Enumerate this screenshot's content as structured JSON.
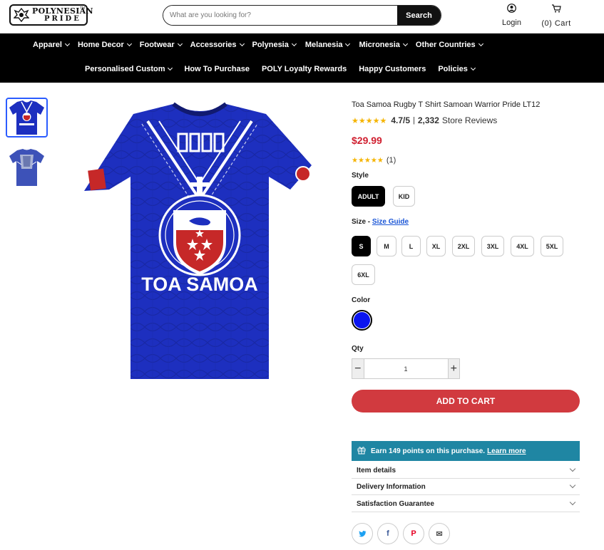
{
  "header": {
    "logo_line1": "POLYNESIAN",
    "logo_line2": "PRIDE",
    "logo_tm": "TM",
    "search_placeholder": "What are you looking for?",
    "search_button": "Search",
    "login_label": "Login",
    "cart_label": "(0) Cart"
  },
  "nav": {
    "row1": [
      {
        "label": "Apparel",
        "chevron": true
      },
      {
        "label": "Home Decor",
        "chevron": true
      },
      {
        "label": "Footwear",
        "chevron": true
      },
      {
        "label": "Accessories",
        "chevron": true
      },
      {
        "label": "Polynesia",
        "chevron": true
      },
      {
        "label": "Melanesia",
        "chevron": true
      },
      {
        "label": "Micronesia",
        "chevron": true
      },
      {
        "label": "Other Countries",
        "chevron": true
      }
    ],
    "row2": [
      {
        "label": "Personalised Custom",
        "chevron": true
      },
      {
        "label": "How To Purchase",
        "chevron": false
      },
      {
        "label": "POLY Loyalty Rewards",
        "chevron": false
      },
      {
        "label": "Happy Customers",
        "chevron": false
      },
      {
        "label": "Policies",
        "chevron": true
      }
    ]
  },
  "product": {
    "image_text": "TOA SAMOA",
    "title": "Toa Samoa Rugby T Shirt Samoan Warrior Pride LT12",
    "store_score": "4.7/5",
    "store_sep": "|",
    "store_count": "2,332",
    "store_reviews_label": "Store Reviews",
    "price": "$29.99",
    "review_count": "(1)",
    "style_label": "Style",
    "styles": [
      {
        "label": "ADULT",
        "selected": true
      },
      {
        "label": "KID",
        "selected": false
      }
    ],
    "size_label": "Size -",
    "size_guide": "Size Guide",
    "sizes": [
      {
        "label": "S",
        "selected": true
      },
      {
        "label": "M",
        "selected": false
      },
      {
        "label": "L",
        "selected": false
      },
      {
        "label": "XL",
        "selected": false
      },
      {
        "label": "2XL",
        "selected": false
      },
      {
        "label": "3XL",
        "selected": false
      },
      {
        "label": "4XL",
        "selected": false
      },
      {
        "label": "5XL",
        "selected": false
      },
      {
        "label": "6XL",
        "selected": false
      }
    ],
    "color_label": "Color",
    "color_value": "#0a14f0",
    "qty_label": "Qty",
    "qty_value": "1",
    "add_to_cart": "ADD TO CART",
    "earn_prefix": "Earn",
    "earn_points": "149",
    "earn_suffix": "points on this purchase.",
    "learn_more": "Learn more",
    "accordions": [
      "Item details",
      "Delivery Information",
      "Satisfaction Guarantee"
    ],
    "share_icons": [
      "twitter-icon",
      "facebook-icon",
      "pinterest-icon",
      "email-icon"
    ]
  },
  "colors": {
    "accent_red": "#d13a3f",
    "price_red": "#d02030",
    "teal": "#1f86a3",
    "link_blue": "#1a55d6",
    "shirt_blue": "#1d2fbf"
  }
}
